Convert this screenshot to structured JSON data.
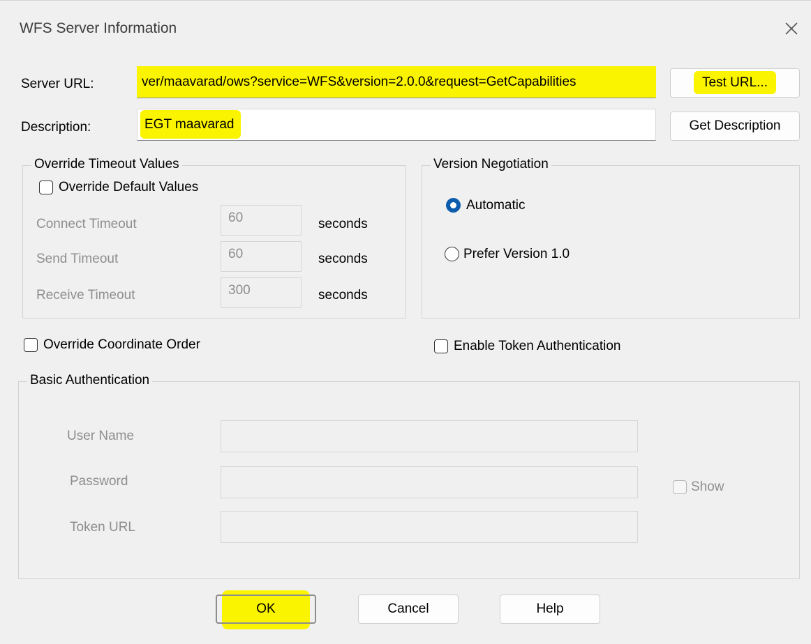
{
  "window": {
    "title": "WFS Server Information",
    "close_icon": "close-icon"
  },
  "server_url": {
    "label": "Server URL:",
    "value": "ver/maavarad/ows?service=WFS&version=2.0.0&request=GetCapabilities",
    "test_button": "Test URL..."
  },
  "description": {
    "label": "Description:",
    "value": "EGT maavarad",
    "get_button": "Get Description"
  },
  "timeouts": {
    "group_title": "Override Timeout Values",
    "override_label": "Override Default Values",
    "override_checked": false,
    "rows": [
      {
        "label": "Connect Timeout",
        "value": "60",
        "unit": "seconds"
      },
      {
        "label": "Send Timeout",
        "value": "60",
        "unit": "seconds"
      },
      {
        "label": "Receive Timeout",
        "value": "300",
        "unit": "seconds"
      }
    ]
  },
  "version": {
    "group_title": "Version Negotiation",
    "options": [
      {
        "label": "Automatic",
        "selected": true
      },
      {
        "label": "Prefer Version 1.0",
        "selected": false
      }
    ]
  },
  "coordinate_order": {
    "label": "Override Coordinate Order",
    "checked": false
  },
  "token_auth": {
    "label": "Enable Token Authentication",
    "checked": false
  },
  "basic_auth": {
    "group_title": "Basic Authentication",
    "user_name_label": "User Name",
    "user_name_value": "",
    "password_label": "Password",
    "password_value": "",
    "show_label": "Show",
    "token_url_label": "Token URL",
    "token_url_value": ""
  },
  "footer": {
    "ok": "OK",
    "cancel": "Cancel",
    "help": "Help"
  },
  "colors": {
    "highlight": "#fbf400",
    "accent": "#0b5cad"
  }
}
